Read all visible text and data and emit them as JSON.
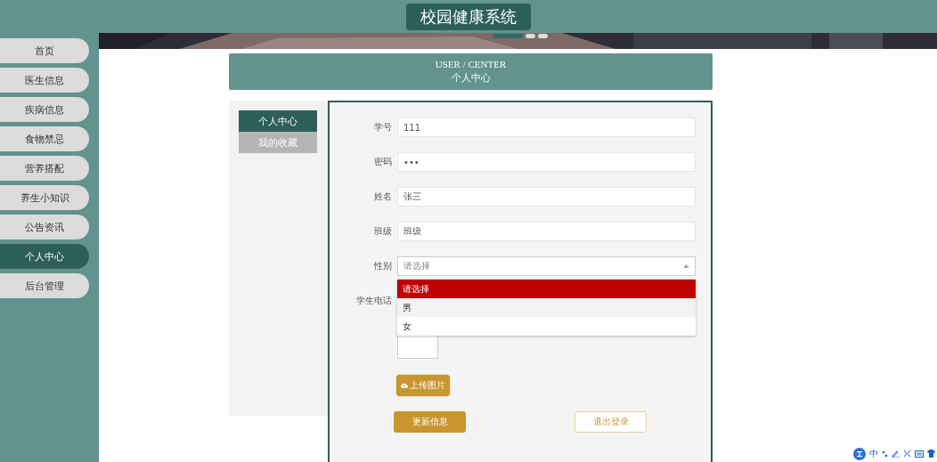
{
  "header": {
    "title": "校园健康系统"
  },
  "sidebar": {
    "items": [
      {
        "label": "首页",
        "selected": false
      },
      {
        "label": "医生信息",
        "selected": false
      },
      {
        "label": "疾病信息",
        "selected": false
      },
      {
        "label": "食物禁忌",
        "selected": false
      },
      {
        "label": "营养搭配",
        "selected": false
      },
      {
        "label": "养生小知识",
        "selected": false
      },
      {
        "label": "公告资讯",
        "selected": false
      },
      {
        "label": "个人中心",
        "selected": true
      },
      {
        "label": "后台管理",
        "selected": false
      }
    ]
  },
  "banner": {
    "kind": "picture",
    "slides": [
      {
        "selected": true
      },
      {
        "selected": false
      },
      {
        "selected": false
      }
    ]
  },
  "page_heading": {
    "title": "USER / CENTER",
    "subtitle": "个人中心"
  },
  "tabs": [
    {
      "label": "个人中心",
      "selected": true
    },
    {
      "label": "我的收藏",
      "selected": false
    }
  ],
  "form": {
    "fields": [
      {
        "kind": "text",
        "label": "学号",
        "value": "111"
      },
      {
        "kind": "text",
        "label": "密码",
        "value": "•••"
      },
      {
        "kind": "text",
        "label": "姓名",
        "value": "张三"
      },
      {
        "kind": "text",
        "label": "班级",
        "value": "班级"
      },
      {
        "kind": "select",
        "label": "性别",
        "placeholder": "请选择",
        "expanded": true,
        "options": [
          {
            "label": "请选择",
            "selected": true,
            "hovered": false
          },
          {
            "label": "男",
            "selected": false,
            "hovered": true
          },
          {
            "label": "女",
            "selected": false,
            "hovered": false
          }
        ]
      },
      {
        "kind": "text",
        "label": "学生电话"
      }
    ],
    "upload_button": "上传图片",
    "buttons": [
      {
        "kind": "primary",
        "label": "更新信息"
      },
      {
        "kind": "outline",
        "label": "退出登录"
      }
    ]
  },
  "ime_bar": {
    "mode": "中"
  }
}
